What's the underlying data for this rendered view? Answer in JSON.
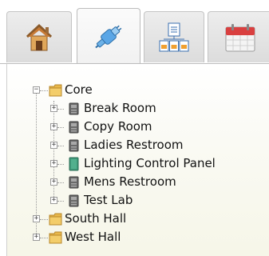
{
  "tabs": [
    {
      "id": "home",
      "icon": "house-icon",
      "active": false
    },
    {
      "id": "network",
      "icon": "network-plug-icon",
      "active": true
    },
    {
      "id": "reports",
      "icon": "reports-icon",
      "active": false
    },
    {
      "id": "calendar",
      "icon": "calendar-icon",
      "active": false
    }
  ],
  "tree": {
    "core": {
      "label": "Core",
      "expanded": true,
      "children": [
        {
          "label": "Break Room",
          "icon": "device-icon"
        },
        {
          "label": "Copy Room",
          "icon": "device-icon"
        },
        {
          "label": "Ladies Restroom",
          "icon": "device-icon"
        },
        {
          "label": "Lighting Control Panel",
          "icon": "panel-icon"
        },
        {
          "label": "Mens Restroom",
          "icon": "device-icon"
        },
        {
          "label": "Test Lab",
          "icon": "device-icon"
        }
      ]
    },
    "south_hall": {
      "label": "South Hall",
      "expanded": false
    },
    "west_hall": {
      "label": "West Hall",
      "expanded": false
    }
  },
  "colors": {
    "folder": "#e8b84a",
    "device": "#6a6a6a",
    "panel": "#3f9a7a"
  }
}
